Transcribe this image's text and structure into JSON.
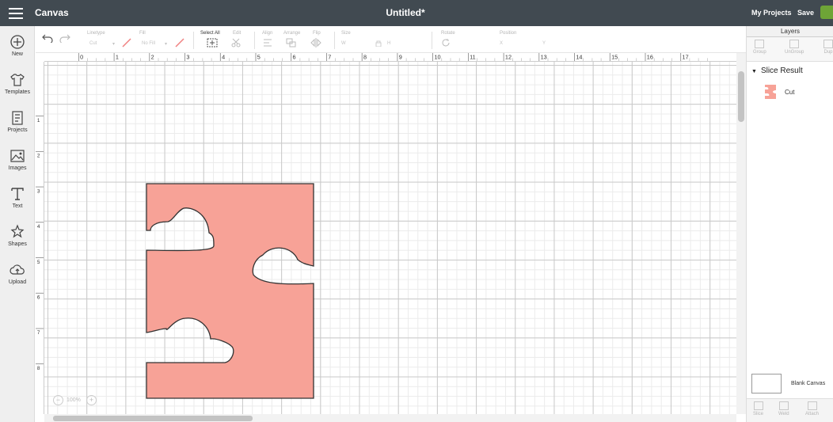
{
  "header": {
    "app_title": "Canvas",
    "doc_title": "Untitled*",
    "my_projects": "My Projects",
    "save": "Save"
  },
  "sidebar": {
    "items": [
      {
        "label": "New",
        "icon": "plus-circle-icon"
      },
      {
        "label": "Templates",
        "icon": "tshirt-icon"
      },
      {
        "label": "Projects",
        "icon": "projects-icon"
      },
      {
        "label": "Images",
        "icon": "image-icon"
      },
      {
        "label": "Text",
        "icon": "text-icon"
      },
      {
        "label": "Shapes",
        "icon": "shapes-icon"
      },
      {
        "label": "Upload",
        "icon": "upload-cloud-icon"
      }
    ]
  },
  "toolbar": {
    "linetype_label": "Linetype",
    "linetype_value": "Cut",
    "fill_label": "Fill",
    "fill_value": "No Fill",
    "select_all": "Select All",
    "edit": "Edit",
    "align": "Align",
    "arrange": "Arrange",
    "flip": "Flip",
    "size": "Size",
    "size_w": "W",
    "size_h": "H",
    "rotate": "Rotate",
    "position": "Position",
    "pos_x": "X",
    "pos_y": "Y"
  },
  "rulers": {
    "top": [
      "0",
      "1",
      "2",
      "3",
      "4",
      "5",
      "6",
      "7",
      "8",
      "9",
      "10",
      "11",
      "12",
      "13",
      "14",
      "15",
      "16",
      "17"
    ],
    "left": [
      "1",
      "2",
      "3",
      "4",
      "5",
      "6",
      "7",
      "8"
    ]
  },
  "zoom": {
    "value": "100%",
    "minus": "−",
    "plus": "+"
  },
  "layers_panel": {
    "tab": "Layers",
    "tools": [
      "Group",
      "UnGroup",
      "Dup"
    ],
    "group_name": "Slice Result",
    "layer_name": "Cut",
    "blank_canvas": "Blank Canvas",
    "bottom_tools": [
      "Slice",
      "Weld",
      "Attach"
    ]
  },
  "colors": {
    "header_bg": "#414a51",
    "design_fill": "#f7a297",
    "accent_green": "#6ea437"
  }
}
